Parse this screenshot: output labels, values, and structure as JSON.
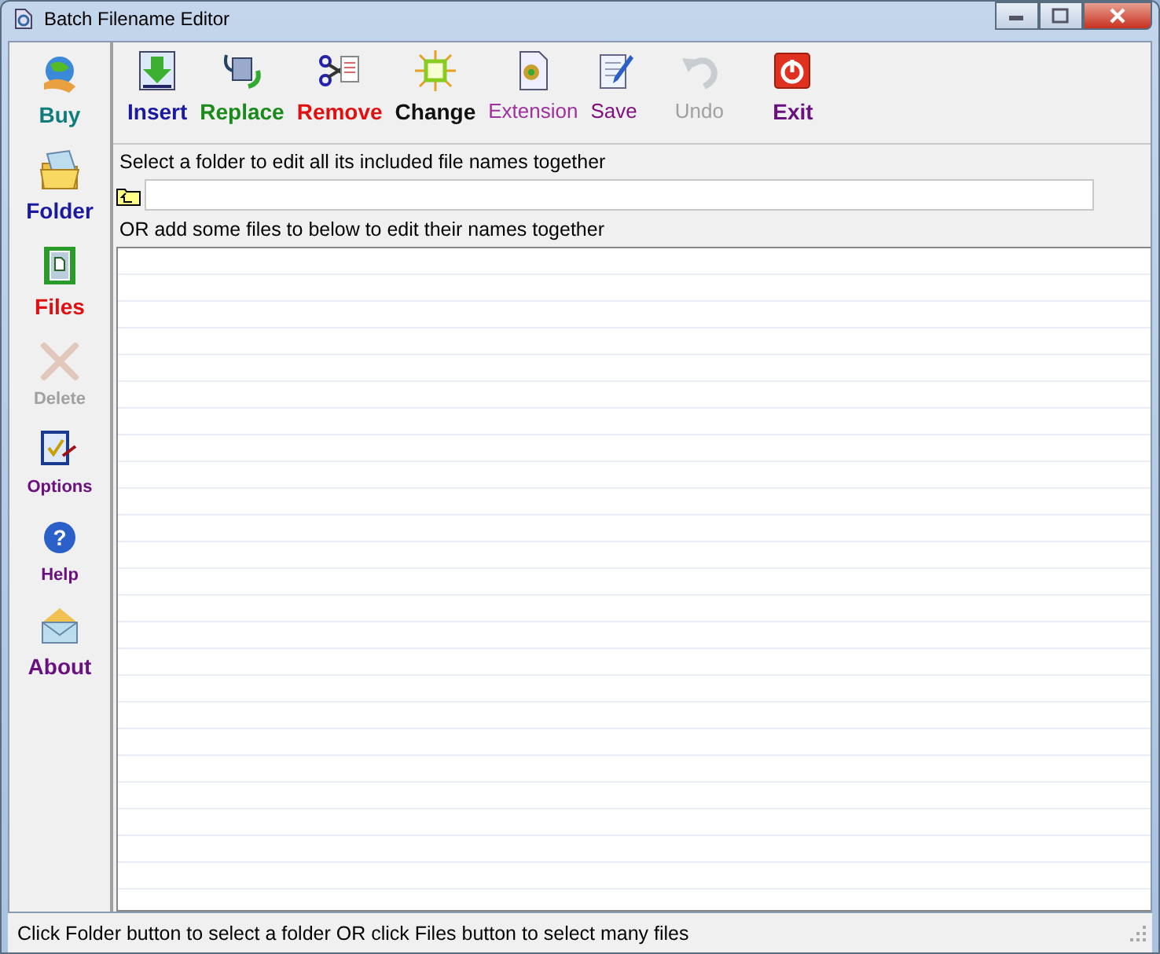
{
  "window": {
    "title": "Batch Filename Editor"
  },
  "sidebar": {
    "items": [
      {
        "label": "Buy",
        "color": "#107c7c",
        "disabled": false,
        "kind": "large"
      },
      {
        "label": "Folder",
        "color": "#1a1aa0",
        "disabled": false,
        "kind": "large"
      },
      {
        "label": "Files",
        "color": "#e01010",
        "disabled": false,
        "kind": "large"
      },
      {
        "label": "Delete",
        "color": "#a0a0a0",
        "disabled": true,
        "kind": "small"
      },
      {
        "label": "Options",
        "color": "#6a1080",
        "disabled": false,
        "kind": "small"
      },
      {
        "label": "Help",
        "color": "#6a1080",
        "disabled": false,
        "kind": "small",
        "glyph": "?"
      },
      {
        "label": "About",
        "color": "#6a1080",
        "disabled": false,
        "kind": "large"
      }
    ]
  },
  "toolbar": {
    "buttons": [
      {
        "label": "Insert",
        "color": "#1a1aa0",
        "disabled": false,
        "kind": "bold"
      },
      {
        "label": "Replace",
        "color": "#1a8a1a",
        "disabled": false,
        "kind": "bold"
      },
      {
        "label": "Remove",
        "color": "#e01010",
        "disabled": false,
        "kind": "bold"
      },
      {
        "label": "Change",
        "color": "#101010",
        "disabled": false,
        "kind": "bold"
      },
      {
        "label": "Extension",
        "color": "#a030a0",
        "disabled": false,
        "kind": "plain"
      },
      {
        "label": "Save",
        "color": "#801080",
        "disabled": false,
        "kind": "plain"
      },
      {
        "label": "Undo",
        "color": "#a0a0a0",
        "disabled": true,
        "kind": "plain"
      },
      {
        "label": "Exit",
        "color": "#6a1080",
        "disabled": false,
        "kind": "bold"
      }
    ]
  },
  "folder_label": "Select a folder to edit all its included file names together",
  "files_label": "OR add some files to below to edit their names together",
  "status_bar": "Click Folder button to select a folder OR click Files button to select many files"
}
